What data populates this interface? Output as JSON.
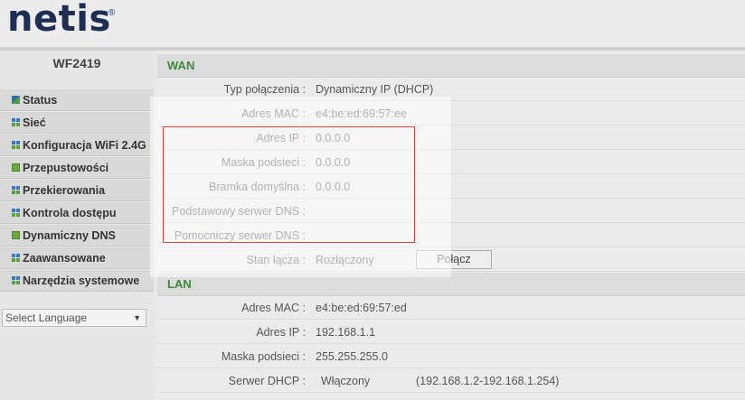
{
  "brand": {
    "logo": "netis",
    "trademark": "®"
  },
  "sidebar": {
    "model": "WF2419",
    "items": [
      {
        "label": "Status",
        "icon": "status-icon"
      },
      {
        "label": "Sieć",
        "icon": "network-icon"
      },
      {
        "label": "Konfiguracja WiFi 2.4G",
        "icon": "wifi-config-icon"
      },
      {
        "label": "Przepustowości",
        "icon": "bandwidth-icon"
      },
      {
        "label": "Przekierowania",
        "icon": "forwarding-icon"
      },
      {
        "label": "Kontrola dostępu",
        "icon": "access-control-icon"
      },
      {
        "label": "Dynamiczny DNS",
        "icon": "ddns-icon"
      },
      {
        "label": "Zaawansowane",
        "icon": "advanced-icon"
      },
      {
        "label": "Narzędzia systemowe",
        "icon": "system-tools-icon"
      }
    ],
    "language": {
      "selected": "Select Language"
    }
  },
  "wan": {
    "title": "WAN",
    "rows": [
      {
        "label": "Typ połączenia :",
        "value": "Dynamiczny IP (DHCP)"
      },
      {
        "label": "Adres MAC :",
        "value": "e4:be:ed:69:57:ee"
      },
      {
        "label": "Adres IP :",
        "value": "0.0.0.0"
      },
      {
        "label": "Maska podsieci :",
        "value": "0.0.0.0"
      },
      {
        "label": "Bramka domyślna :",
        "value": "0.0.0.0"
      },
      {
        "label": "Podstawowy serwer DNS :",
        "value": ""
      },
      {
        "label": "Pomocniczy serwer DNS :",
        "value": ""
      }
    ],
    "link_status": {
      "label": "Stan łącza :",
      "value": "Rozłączony",
      "button": "Połącz"
    }
  },
  "lan": {
    "title": "LAN",
    "rows": [
      {
        "label": "Adres MAC :",
        "value": "e4:be:ed:69:57:ed"
      },
      {
        "label": "Adres IP :",
        "value": "192.168.1.1"
      },
      {
        "label": "Maska podsieci :",
        "value": "255.255.255.0"
      }
    ],
    "dhcp": {
      "label": "Serwer DHCP :",
      "value": "Włączony",
      "range": "(192.168.1.2-192.168.1.254)"
    }
  },
  "colors": {
    "logo": "#1d2e55",
    "section_title": "#3d8a3a",
    "highlight_box": "#cc4444"
  }
}
